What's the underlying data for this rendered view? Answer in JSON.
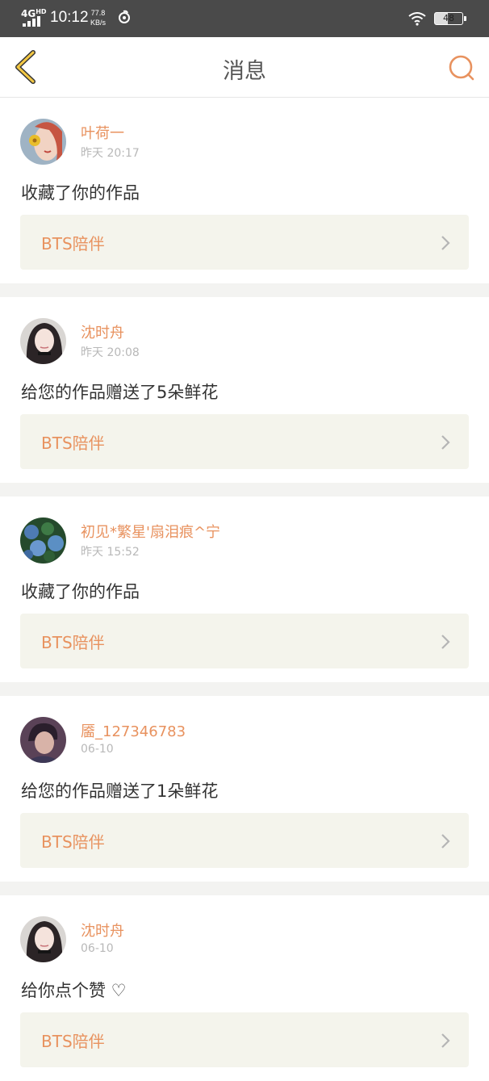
{
  "status_bar": {
    "network": "4G",
    "network_sup": "HD",
    "time": "10:12",
    "speed_value": "77.8",
    "speed_unit": "KB/s",
    "battery": "48"
  },
  "header": {
    "title": "消息",
    "back_icon": "chevron-left-icon",
    "search_icon": "search-icon"
  },
  "accent_color": "#e8925f",
  "messages": [
    {
      "user": "叶荷一",
      "time": "昨天 20:17",
      "action": "收藏了你的作品",
      "work": "BTS陪伴"
    },
    {
      "user": "沈时舟",
      "time": "昨天 20:08",
      "action": "给您的作品赠送了5朵鲜花",
      "work": "BTS陪伴"
    },
    {
      "user": "初见*繁星'扇泪痕^宁",
      "time": "昨天 15:52",
      "action": "收藏了你的作品",
      "work": "BTS陪伴"
    },
    {
      "user": "靥_127346783",
      "time": "06-10",
      "action": "给您的作品赠送了1朵鲜花",
      "work": "BTS陪伴"
    },
    {
      "user": "沈时舟",
      "time": "06-10",
      "action": "给你点个赞 ♡",
      "work": "BTS陪伴"
    }
  ]
}
